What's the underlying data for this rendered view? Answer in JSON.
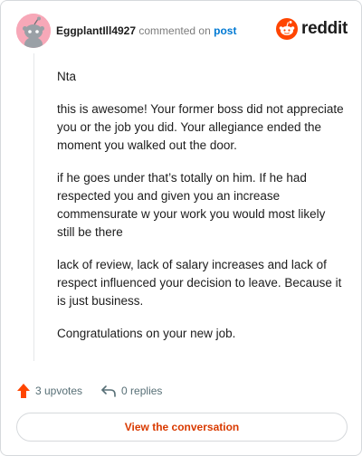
{
  "comment": {
    "username": "EggplantIll4927",
    "action_text": "commented on",
    "post_link": "post",
    "paragraphs": [
      "Nta",
      "this is awesome! Your former boss did not appreciate you or the job you did. Your allegiance ended the moment you walked out the door.",
      "if he goes under that’s totally on him. If he had respected you and given you an increase commensurate w your work you would most likely still be there",
      "lack of review, lack of salary increases and lack of respect influenced your decision to leave. Because it is just business.",
      "Congratulations on your new job."
    ]
  },
  "brand": {
    "logo_text": "reddit",
    "color": "#ff4500"
  },
  "footer": {
    "upvotes": "3 upvotes",
    "replies": "0 replies",
    "cta_label": "View the conversation",
    "upvote_icon": "upvote-arrow-icon",
    "reply_icon": "reply-arrow-icon"
  },
  "colors": {
    "accent": "#d93a00",
    "link": "#0079d3",
    "upvote": "#ff4500",
    "avatar_bg": "#f7a8b8"
  }
}
